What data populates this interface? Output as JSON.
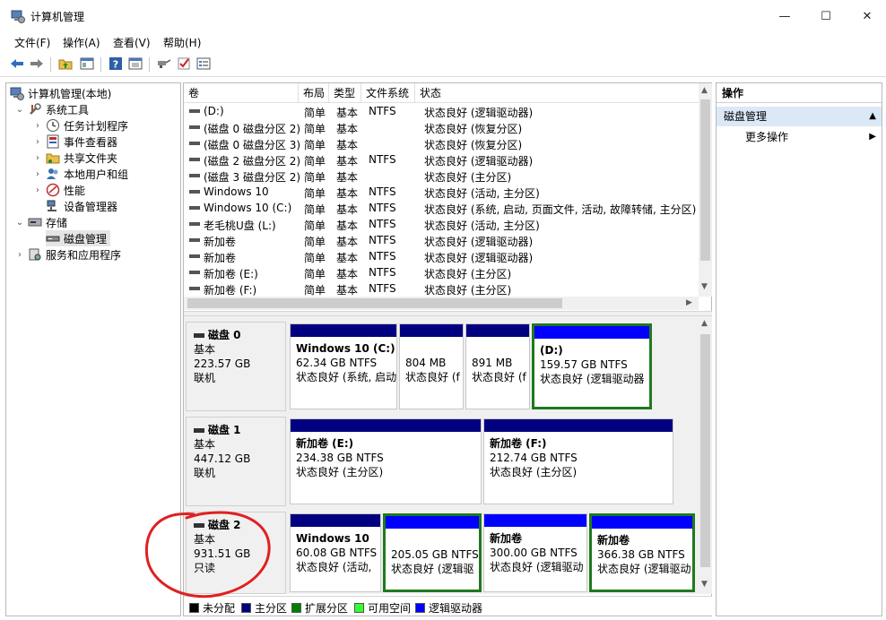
{
  "window": {
    "title": "计算机管理",
    "min_glyph": "—",
    "max_glyph": "☐",
    "close_glyph": "✕"
  },
  "menu": [
    "文件(F)",
    "操作(A)",
    "查看(V)",
    "帮助(H)"
  ],
  "toolbar_icons": [
    "back-arrow-icon",
    "forward-arrow-icon",
    "up-folder-icon",
    "show-hide-tree-icon",
    "help-icon",
    "properties-icon",
    "connect-icon",
    "check-icon",
    "list-icon"
  ],
  "tree": {
    "root": "计算机管理(本地)",
    "system_tools": "系统工具",
    "task_scheduler": "任务计划程序",
    "event_viewer": "事件查看器",
    "shared_folders": "共享文件夹",
    "local_users": "本地用户和组",
    "performance": "性能",
    "device_manager": "设备管理器",
    "storage": "存储",
    "disk_management": "磁盘管理",
    "services": "服务和应用程序"
  },
  "columns": [
    "卷",
    "布局",
    "类型",
    "文件系统",
    "状态"
  ],
  "volumes": [
    {
      "name": "(D:)",
      "layout": "简单",
      "type": "基本",
      "fs": "NTFS",
      "status": "状态良好 (逻辑驱动器)"
    },
    {
      "name": "(磁盘 0 磁盘分区 2)",
      "layout": "简单",
      "type": "基本",
      "fs": "",
      "status": "状态良好 (恢复分区)"
    },
    {
      "name": "(磁盘 0 磁盘分区 3)",
      "layout": "简单",
      "type": "基本",
      "fs": "",
      "status": "状态良好 (恢复分区)"
    },
    {
      "name": "(磁盘 2 磁盘分区 2)",
      "layout": "简单",
      "type": "基本",
      "fs": "NTFS",
      "status": "状态良好 (逻辑驱动器)"
    },
    {
      "name": "(磁盘 3 磁盘分区 2)",
      "layout": "简单",
      "type": "基本",
      "fs": "",
      "status": "状态良好 (主分区)"
    },
    {
      "name": "Windows 10",
      "layout": "简单",
      "type": "基本",
      "fs": "NTFS",
      "status": "状态良好 (活动, 主分区)"
    },
    {
      "name": "Windows 10 (C:)",
      "layout": "简单",
      "type": "基本",
      "fs": "NTFS",
      "status": "状态良好 (系统, 启动, 页面文件, 活动, 故障转储, 主分区)"
    },
    {
      "name": "老毛桃U盘 (L:)",
      "layout": "简单",
      "type": "基本",
      "fs": "NTFS",
      "status": "状态良好 (活动, 主分区)"
    },
    {
      "name": "新加卷",
      "layout": "简单",
      "type": "基本",
      "fs": "NTFS",
      "status": "状态良好 (逻辑驱动器)"
    },
    {
      "name": "新加卷",
      "layout": "简单",
      "type": "基本",
      "fs": "NTFS",
      "status": "状态良好 (逻辑驱动器)"
    },
    {
      "name": "新加卷 (E:)",
      "layout": "简单",
      "type": "基本",
      "fs": "NTFS",
      "status": "状态良好 (主分区)"
    },
    {
      "name": "新加卷 (F:)",
      "layout": "简单",
      "type": "基本",
      "fs": "NTFS",
      "status": "状态良好 (主分区)"
    }
  ],
  "disks": [
    {
      "name": "磁盘 0",
      "type": "基本",
      "size": "223.57 GB",
      "state": "联机",
      "parts": [
        {
          "name": "Windows 10  (C:)",
          "size": "62.34 GB NTFS",
          "status": "状态良好 (系统, 启动"
        },
        {
          "name": "",
          "size": "804 MB",
          "status": "状态良好 (f"
        },
        {
          "name": "",
          "size": "891 MB",
          "status": "状态良好 (f"
        },
        {
          "name": "(D:)",
          "size": "159.57 GB NTFS",
          "status": "状态良好 (逻辑驱动器"
        }
      ]
    },
    {
      "name": "磁盘 1",
      "type": "基本",
      "size": "447.12 GB",
      "state": "联机",
      "parts": [
        {
          "name": "新加卷  (E:)",
          "size": "234.38 GB NTFS",
          "status": "状态良好 (主分区)"
        },
        {
          "name": "新加卷  (F:)",
          "size": "212.74 GB NTFS",
          "status": "状态良好 (主分区)"
        }
      ]
    },
    {
      "name": "磁盘 2",
      "type": "基本",
      "size": "931.51 GB",
      "state": "只读",
      "parts": [
        {
          "name": "Windows 10",
          "size": "60.08 GB NTFS",
          "status": "状态良好 (活动,"
        },
        {
          "name": "",
          "size": "205.05 GB NTFS",
          "status": "状态良好 (逻辑驱"
        },
        {
          "name": "新加卷",
          "size": "300.00 GB NTFS",
          "status": "状态良好 (逻辑驱动"
        },
        {
          "name": "新加卷",
          "size": "366.38 GB NTFS",
          "status": "状态良好 (逻辑驱动"
        }
      ]
    }
  ],
  "legend": [
    {
      "label": "未分配",
      "color": "#000000"
    },
    {
      "label": "主分区",
      "color": "#000080"
    },
    {
      "label": "扩展分区",
      "color": "#008000"
    },
    {
      "label": "可用空间",
      "color": "#33ff33"
    },
    {
      "label": "逻辑驱动器",
      "color": "#0000ff"
    }
  ],
  "actions": {
    "header": "操作",
    "section": "磁盘管理",
    "more": "更多操作"
  },
  "colors": {
    "primary_bar": "#000080",
    "logical_bar": "#0000ff",
    "extended_border": "#1f7a1f",
    "annotation": "#e02020"
  }
}
